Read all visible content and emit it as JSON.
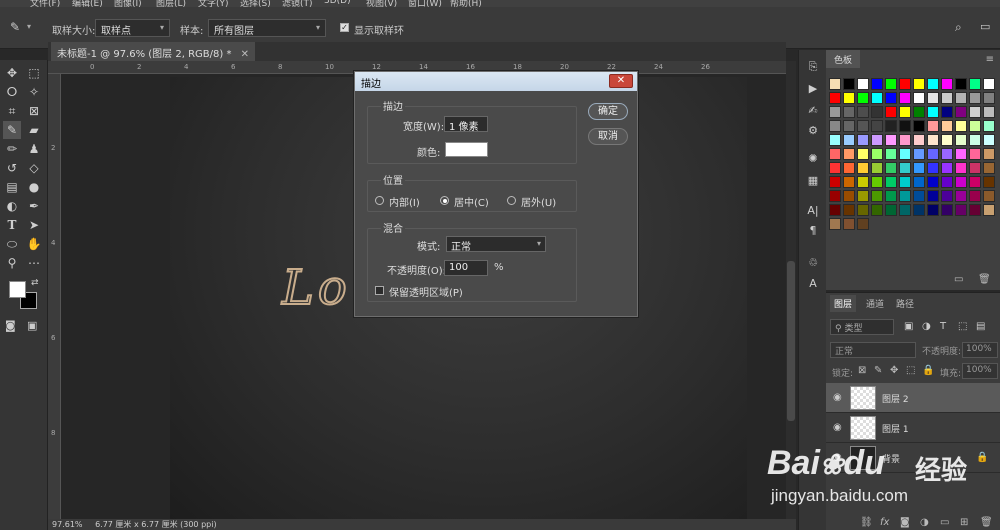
{
  "menubar": {
    "items": [
      "文件(F)",
      "编辑(E)",
      "图像(I)",
      "图层(L)",
      "文字(Y)",
      "选择(S)",
      "滤镜(T)",
      "3D(D)",
      "视图(V)",
      "窗口(W)",
      "帮助(H)"
    ]
  },
  "options": {
    "sample_size_label": "取样大小:",
    "sample_size_value": "取样点",
    "sample_label": "样本:",
    "sample_value": "所有图层",
    "show_ring_label": "显示取样环"
  },
  "document": {
    "tab_title": "未标题-1 @ 97.6% (图层 2, RGB/8) *",
    "canvas_text": "Lo",
    "ruler_top": [
      "0",
      "2",
      "4",
      "6",
      "8",
      "10",
      "12",
      "14",
      "16",
      "18",
      "20",
      "22",
      "24",
      "26"
    ],
    "ruler_left": [
      "2",
      "4",
      "6",
      "8"
    ]
  },
  "status": {
    "zoom": "97.61%",
    "doc_info": "6.77 厘米 x 6.77 厘米 (300 ppi)"
  },
  "dialog": {
    "title": "描边",
    "stroke_group": "描边",
    "width_label": "宽度(W):",
    "width_value": "1 像素",
    "color_label": "颜色:",
    "stroke_color": "#ffffff",
    "position_group": "位置",
    "inside_label": "内部(I)",
    "center_label": "居中(C)",
    "outside_label": "居外(U)",
    "blend_group": "混合",
    "mode_label": "模式:",
    "mode_value": "正常",
    "opacity_label": "不透明度(O):",
    "opacity_value": "100",
    "opacity_unit": "%",
    "preserve_label": "保留透明区域(P)",
    "ok_label": "确定",
    "cancel_label": "取消"
  },
  "swatches_panel": {
    "tab": "色板",
    "colors": [
      "#f5deb3",
      "#000000",
      "#ffffff",
      "#0000ff",
      "#00ff00",
      "#ff0000",
      "#ffff00",
      "#00ffff",
      "#ff00ff",
      "#000000",
      "#00ff88",
      "#ffffff",
      "#ff0000",
      "#ffff00",
      "#00ff00",
      "#00ffff",
      "#0000ff",
      "#ff00ff",
      "#ffffff",
      "#e6e6e6",
      "#cccccc",
      "#b3b3b3",
      "#999999",
      "#808080",
      "#999999",
      "#666666",
      "#4d4d4d",
      "#333333",
      "#ff0000",
      "#ffff00",
      "#008000",
      "#00ffff",
      "#000080",
      "#800080",
      "#d0d0d0",
      "#bbbbbb",
      "#888888",
      "#666666",
      "#555555",
      "#444444",
      "#222222",
      "#111111",
      "#000000",
      "#ff9999",
      "#ffcc99",
      "#ffff99",
      "#ccff99",
      "#99ffcc",
      "#99ffff",
      "#99ccff",
      "#9999ff",
      "#cc99ff",
      "#ff99ff",
      "#ff99cc",
      "#ffcccc",
      "#ffe5cc",
      "#ffffcc",
      "#e5ffcc",
      "#ccffe5",
      "#ccffff",
      "#ff6666",
      "#ff9966",
      "#ffff66",
      "#99ff66",
      "#66ff99",
      "#66ffff",
      "#6699ff",
      "#6666ff",
      "#9966ff",
      "#ff66ff",
      "#ff6699",
      "#cc9966",
      "#ff3333",
      "#ff6633",
      "#ffcc33",
      "#99cc33",
      "#33cc66",
      "#33cccc",
      "#3399ff",
      "#3333ff",
      "#9933ff",
      "#ff33cc",
      "#cc3366",
      "#996633",
      "#cc0000",
      "#cc6600",
      "#cccc00",
      "#66cc00",
      "#00cc66",
      "#00cccc",
      "#0066cc",
      "#0000cc",
      "#6600cc",
      "#cc00cc",
      "#cc0066",
      "#663300",
      "#990000",
      "#994c00",
      "#999900",
      "#4c9900",
      "#00994c",
      "#009999",
      "#004c99",
      "#000099",
      "#4c0099",
      "#990099",
      "#99004c",
      "#8b5a2b",
      "#660000",
      "#663300",
      "#666600",
      "#336600",
      "#006633",
      "#006666",
      "#003366",
      "#000066",
      "#330066",
      "#660066",
      "#660033",
      "#c8a070",
      "#a07850",
      "#805030",
      "#604020"
    ]
  },
  "layers_panel": {
    "tabs": [
      "图层",
      "通道",
      "路径"
    ],
    "filter_label": "类型",
    "blend_label": "正常",
    "opacity_label": "不透明度:",
    "opacity_value": "100%",
    "lock_label": "锁定:",
    "fill_label": "填充:",
    "fill_value": "100%",
    "layers": [
      {
        "name": "图层 2"
      },
      {
        "name": "图层 1"
      },
      {
        "name": "背景"
      }
    ]
  },
  "watermark": {
    "brand": "Bai",
    "brand2": "du",
    "cn": "经验",
    "url": "jingyan.baidu.com"
  }
}
